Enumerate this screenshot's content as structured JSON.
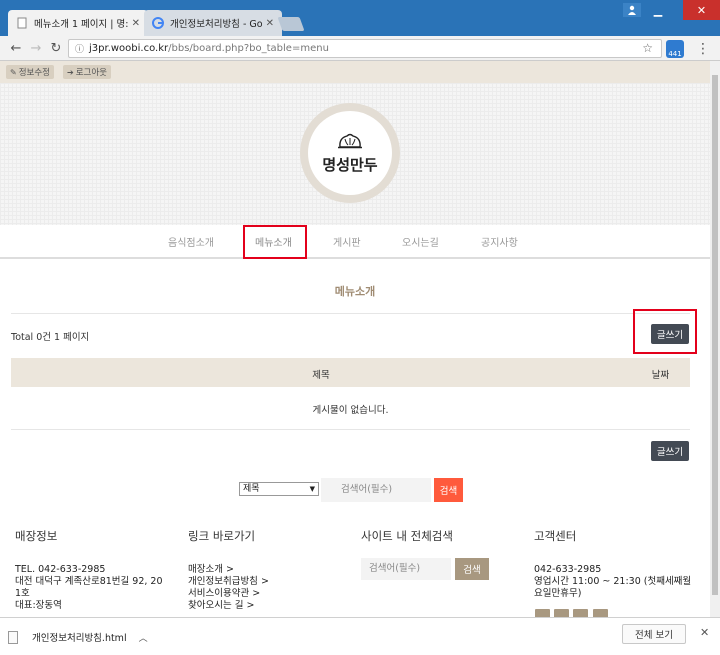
{
  "browser": {
    "tabs": [
      {
        "label": "메뉴소개 1 페이지 | 명:",
        "active": true
      },
      {
        "label": "개인정보처리방침 - Goo",
        "active": false
      }
    ],
    "url_host": "j3pr.woobi.co.kr",
    "url_path": "/bbs/board.php?bo_table=menu",
    "ext_badge": "441"
  },
  "topbar": {
    "edit_info": "정보수정",
    "logout": "로그아웃"
  },
  "logo": {
    "text": "명성만두"
  },
  "nav": {
    "items": [
      "음식점소개",
      "메뉴소개",
      "게시판",
      "오시는길",
      "공지사항"
    ]
  },
  "board": {
    "title": "메뉴소개",
    "total": "Total 0건 1 페이지",
    "write_label": "글쓰기",
    "col_subject": "제목",
    "col_date": "날짜",
    "empty_message": "게시물이 없습니다."
  },
  "search": {
    "select_value": "제목",
    "placeholder": "검색어(필수)",
    "button": "검색"
  },
  "footer": {
    "store": {
      "heading": "매장정보",
      "lines": [
        "TEL. 042-633-2985",
        "대전 대덕구 계족산로81번길 92, 20",
        "1호",
        "대표:장동역"
      ]
    },
    "links": {
      "heading": "링크 바로가기",
      "items": [
        "매장소개 >",
        "개인정보취급방침 >",
        "서비스이용약관 >",
        "찾아오시는 길 >"
      ]
    },
    "site_search": {
      "heading": "사이트 내 전체검색",
      "placeholder": "검색어(필수)",
      "button": "검색"
    },
    "support": {
      "heading": "고객센터",
      "phone": "042-633-2985",
      "hours": "영업시간 11:00 ~ 21:30 (첫째세째월",
      "holiday": "요일만휴무)"
    }
  },
  "downloads": {
    "file": "개인정보처리방침.html",
    "show_all": "전체 보기"
  },
  "colors": {
    "accent_brown": "#a89880",
    "title_brown": "#a08c73",
    "write_btn": "#434a54",
    "search_btn": "#ff5a3c",
    "highlight": "#e3001b",
    "browser_blue": "#2a73b7"
  }
}
